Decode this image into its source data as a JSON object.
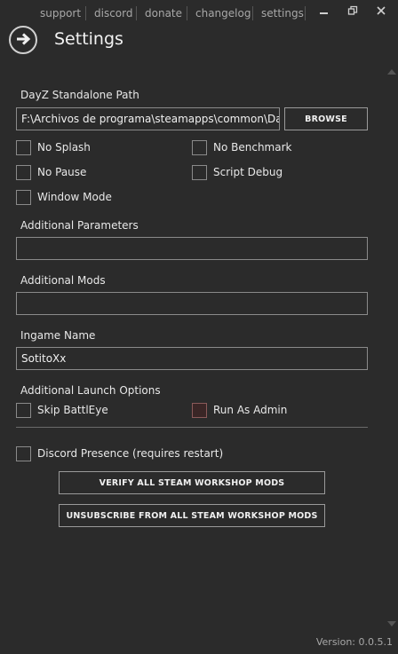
{
  "nav": {
    "support": "support",
    "discord": "discord",
    "donate": "donate",
    "changelog": "changelog",
    "settings": "settings"
  },
  "window": {
    "minimize": "▁",
    "restore": "🗗",
    "close": "✕"
  },
  "page": {
    "title": "Settings"
  },
  "path": {
    "label": "DayZ Standalone Path",
    "value": "F:\\Archivos de programa\\steamapps\\common\\DayZ",
    "browse": "BROWSE"
  },
  "options": {
    "no_splash": "No Splash",
    "no_benchmark": "No Benchmark",
    "no_pause": "No Pause",
    "script_debug": "Script Debug",
    "window_mode": "Window Mode"
  },
  "additional_parameters": {
    "label": "Additional Parameters",
    "value": ""
  },
  "additional_mods": {
    "label": "Additional Mods",
    "value": ""
  },
  "ingame_name": {
    "label": "Ingame Name",
    "value": "SotitoXx"
  },
  "launch_options": {
    "label": "Additional Launch Options",
    "skip_battleye": "Skip BattlEye",
    "run_as_admin": "Run As Admin"
  },
  "discord_presence": "Discord Presence (requires restart)",
  "buttons": {
    "verify": "VERIFY ALL STEAM WORKSHOP MODS",
    "unsubscribe": "UNSUBSCRIBE FROM ALL STEAM WORKSHOP MODS"
  },
  "version": "Version: 0.0.5.1",
  "colors": {
    "background": "#2b2b2b",
    "border": "#8a8a8a",
    "text": "#e8e8e8",
    "muted": "#a8a8a8"
  },
  "icons": {
    "back": "arrow-right-circle-icon",
    "scroll_up": "triangle-up-icon",
    "scroll_down": "triangle-down-icon"
  }
}
